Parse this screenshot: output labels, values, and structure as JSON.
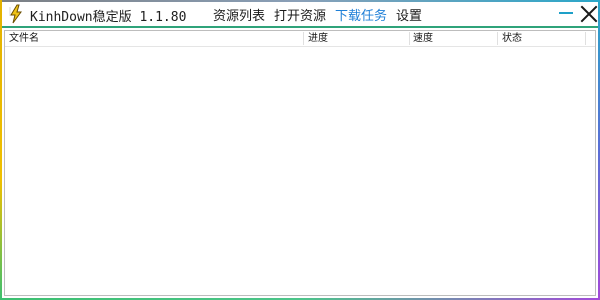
{
  "window": {
    "title": "KinhDown稳定版 1.1.80"
  },
  "nav": {
    "items": [
      {
        "label": "资源列表"
      },
      {
        "label": "打开资源"
      },
      {
        "label": "下载任务",
        "active": true
      },
      {
        "label": "设置"
      }
    ]
  },
  "table": {
    "columns": [
      "文件名",
      "进度",
      "速度",
      "状态"
    ],
    "rows": []
  },
  "colors": {
    "active_tab": "#1e7fd7",
    "title_separator": "#2fa37a",
    "minimize_accent": "#1ea0c8"
  },
  "icons": {
    "app": "lightning-bolt-icon",
    "minimize": "minimize-icon",
    "close": "close-icon"
  }
}
